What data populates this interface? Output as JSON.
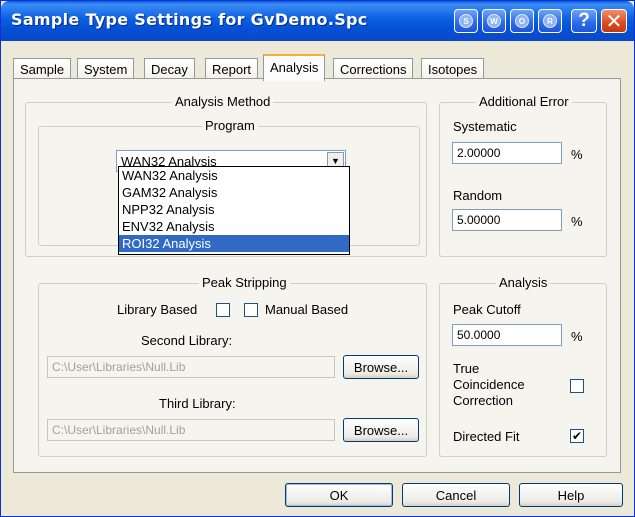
{
  "window": {
    "title": "Sample Type Settings for GvDemo.Spc",
    "title_buttons": [
      "S",
      "W",
      "O",
      "R"
    ],
    "help_glyph": "?",
    "close_glyph": "✕"
  },
  "tabs": [
    {
      "label": "Sample"
    },
    {
      "label": "System"
    },
    {
      "label": "Decay"
    },
    {
      "label": "Report"
    },
    {
      "label": "Analysis",
      "active": true
    },
    {
      "label": "Corrections"
    },
    {
      "label": "Isotopes"
    }
  ],
  "analysis_method": {
    "title": "Analysis Method",
    "program_title": "Program",
    "selected": "WAN32 Analysis",
    "options": [
      "WAN32 Analysis",
      "GAM32 Analysis",
      "NPP32 Analysis",
      "ENV32 Analysis",
      "ROI32 Analysis"
    ],
    "highlighted_index": 4
  },
  "additional_error": {
    "title": "Additional Error",
    "systematic_label": "Systematic",
    "systematic_value": "2.00000",
    "random_label": "Random",
    "random_value": "5.00000",
    "unit": "%"
  },
  "peak_stripping": {
    "title": "Peak Stripping",
    "library_based_label": "Library Based",
    "library_based_checked": false,
    "manual_based_label": "Manual Based",
    "manual_based_checked": false,
    "second_library_label": "Second Library:",
    "second_library_value": "C:\\User\\Libraries\\Null.Lib",
    "third_library_label": "Third Library:",
    "third_library_value": "C:\\User\\Libraries\\Null.Lib",
    "browse_label": "Browse..."
  },
  "analysis": {
    "title": "Analysis",
    "peak_cutoff_label": "Peak Cutoff",
    "peak_cutoff_value": "50.0000",
    "unit": "%",
    "true_coincidence_line1": "True",
    "true_coincidence_line2": "Coincidence",
    "true_coincidence_line3": "Correction",
    "true_coincidence_checked": false,
    "directed_fit_label": "Directed Fit",
    "directed_fit_checked": true,
    "check_glyph": "✔"
  },
  "footer": {
    "ok_label": "OK",
    "cancel_label": "Cancel",
    "help_label": "Help"
  }
}
